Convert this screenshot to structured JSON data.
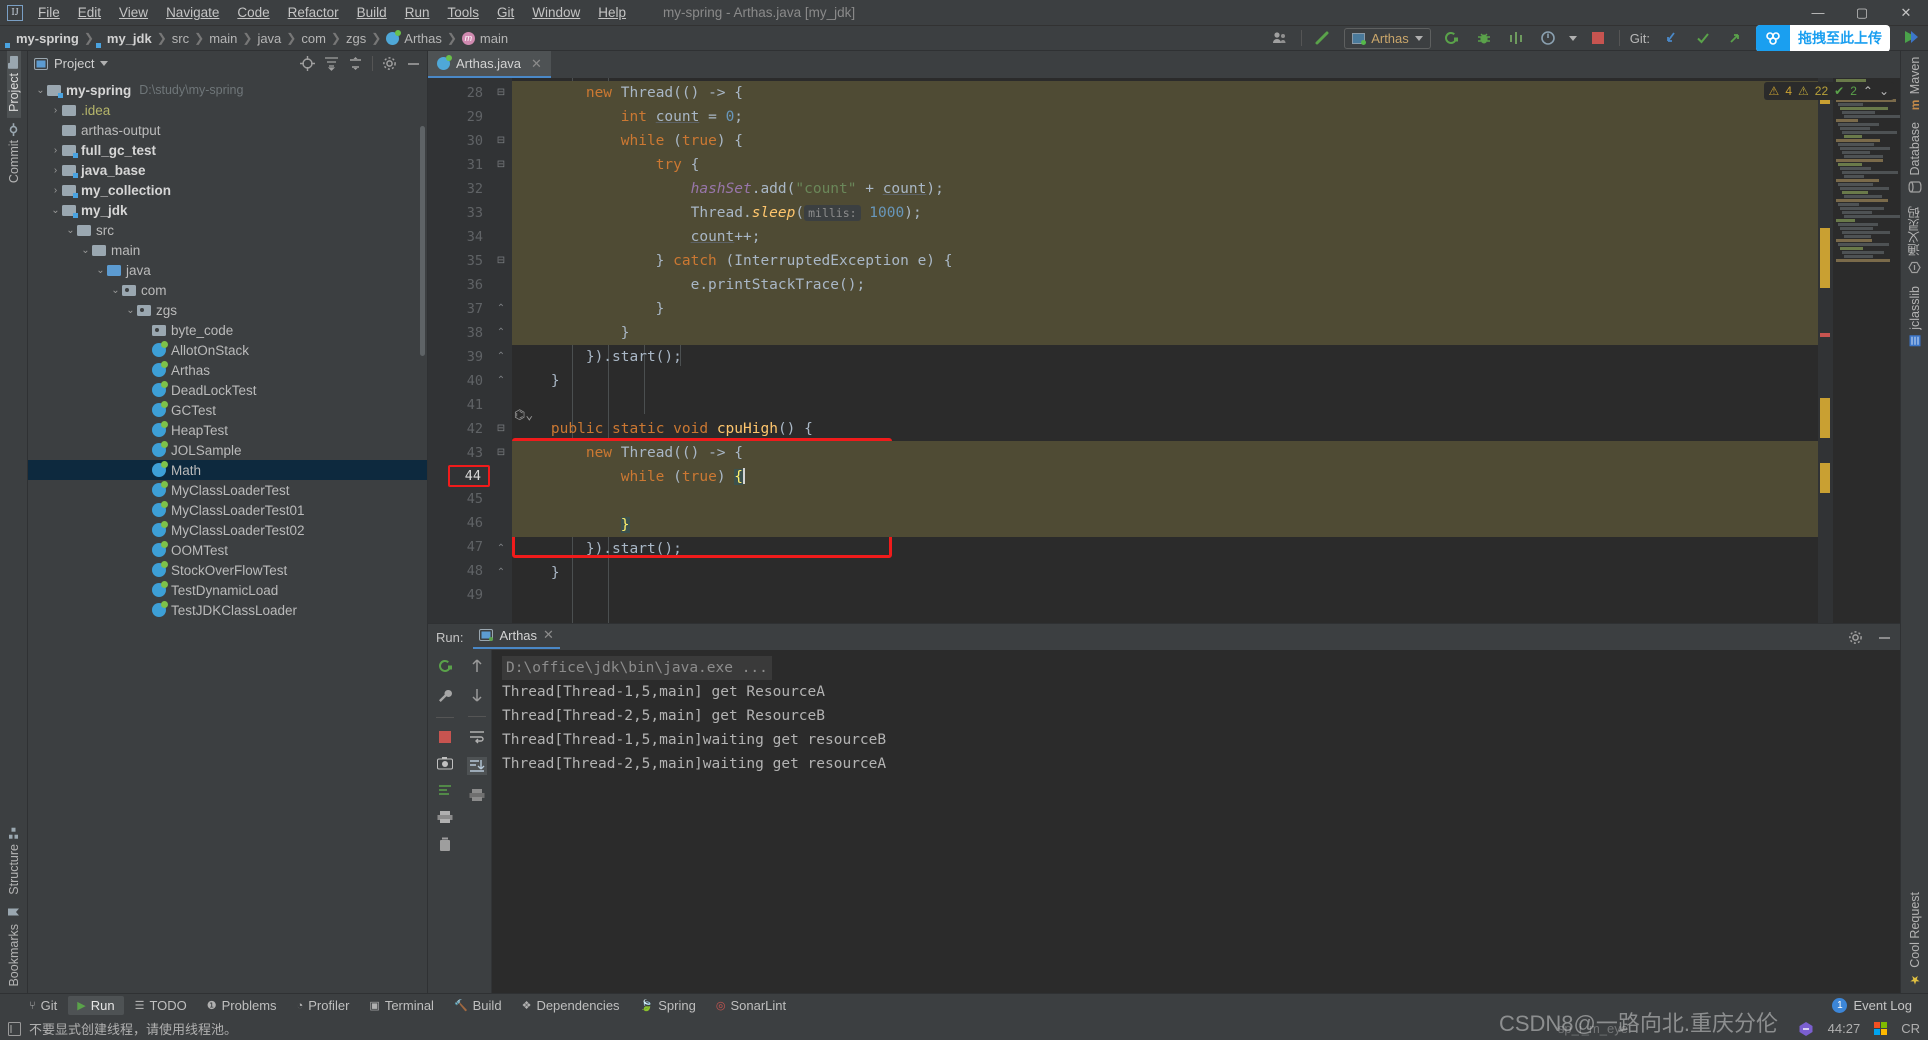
{
  "window": {
    "title": "my-spring - Arthas.java [my_jdk]",
    "logo": "intellij-idea-logo",
    "minimize": "—",
    "maximize": "▢",
    "close": "✕"
  },
  "menu": [
    "File",
    "Edit",
    "View",
    "Navigate",
    "Code",
    "Refactor",
    "Build",
    "Run",
    "Tools",
    "Git",
    "Window",
    "Help"
  ],
  "navbar": {
    "crumbs": [
      {
        "label": "my-spring",
        "bold": true,
        "icon": ""
      },
      {
        "label": "my_jdk",
        "bold": true,
        "icon": ""
      },
      {
        "label": "src",
        "bold": false,
        "icon": ""
      },
      {
        "label": "main",
        "bold": false,
        "icon": ""
      },
      {
        "label": "java",
        "bold": false,
        "icon": ""
      },
      {
        "label": "com",
        "bold": false,
        "icon": ""
      },
      {
        "label": "zgs",
        "bold": false,
        "icon": ""
      },
      {
        "label": "Arthas",
        "bold": false,
        "icon": "class-icon"
      },
      {
        "label": "main",
        "bold": false,
        "icon": "method-icon"
      }
    ],
    "run_config": "Arthas",
    "git_label": "Git:",
    "upload_widget": "拖拽至此上传",
    "icons": [
      "user-group-icon",
      "build-hammer-icon",
      "rerun-icon",
      "debug-bug-icon",
      "coverage-icon",
      "profiler-icon",
      "stop-icon",
      "git-update-icon",
      "git-commit-icon",
      "git-push-icon",
      "search-icon"
    ]
  },
  "left_rail": {
    "top": [
      {
        "label": "Project",
        "selected": true
      },
      {
        "label": "Commit",
        "selected": false
      }
    ],
    "bottom": [
      {
        "label": "Structure",
        "selected": false
      },
      {
        "label": "Bookmarks",
        "selected": false
      }
    ]
  },
  "right_rail": {
    "items": [
      "Maven",
      "Database",
      "通义灵码",
      "jclasslib",
      "Cool Request"
    ]
  },
  "project_panel": {
    "title": "Project",
    "tools": [
      "target-icon",
      "expand-all-icon",
      "collapse-all-icon",
      "settings-gear-icon",
      "hide-icon"
    ],
    "tree": [
      {
        "depth": 0,
        "arrow": "v",
        "icon": "module-folder",
        "label": "my-spring",
        "bold": true,
        "path": "D:\\study\\my-spring"
      },
      {
        "depth": 1,
        "arrow": ">",
        "icon": "folder",
        "label": ".idea",
        "color": "yellow"
      },
      {
        "depth": 1,
        "arrow": "",
        "icon": "folder",
        "label": "arthas-output"
      },
      {
        "depth": 1,
        "arrow": ">",
        "icon": "module-folder",
        "label": "full_gc_test",
        "bold": true
      },
      {
        "depth": 1,
        "arrow": ">",
        "icon": "module-folder",
        "label": "java_base",
        "bold": true
      },
      {
        "depth": 1,
        "arrow": ">",
        "icon": "module-folder",
        "label": "my_collection",
        "bold": true
      },
      {
        "depth": 1,
        "arrow": "v",
        "icon": "module-folder",
        "label": "my_jdk",
        "bold": true
      },
      {
        "depth": 2,
        "arrow": "v",
        "icon": "folder",
        "label": "src"
      },
      {
        "depth": 3,
        "arrow": "v",
        "icon": "folder",
        "label": "main"
      },
      {
        "depth": 4,
        "arrow": "v",
        "icon": "source-folder",
        "label": "java"
      },
      {
        "depth": 5,
        "arrow": "v",
        "icon": "package",
        "label": "com"
      },
      {
        "depth": 6,
        "arrow": "v",
        "icon": "package",
        "label": "zgs"
      },
      {
        "depth": 7,
        "arrow": "",
        "icon": "package",
        "label": "byte_code"
      },
      {
        "depth": 7,
        "arrow": "",
        "icon": "java-class",
        "label": "AllotOnStack"
      },
      {
        "depth": 7,
        "arrow": "",
        "icon": "java-class",
        "label": "Arthas"
      },
      {
        "depth": 7,
        "arrow": "",
        "icon": "java-class",
        "label": "DeadLockTest"
      },
      {
        "depth": 7,
        "arrow": "",
        "icon": "java-class",
        "label": "GCTest"
      },
      {
        "depth": 7,
        "arrow": "",
        "icon": "java-class",
        "label": "HeapTest"
      },
      {
        "depth": 7,
        "arrow": "",
        "icon": "java-class",
        "label": "JOLSample"
      },
      {
        "depth": 7,
        "arrow": "",
        "icon": "java-class",
        "label": "Math",
        "selected": true
      },
      {
        "depth": 7,
        "arrow": "",
        "icon": "java-class",
        "label": "MyClassLoaderTest"
      },
      {
        "depth": 7,
        "arrow": "",
        "icon": "java-class",
        "label": "MyClassLoaderTest01"
      },
      {
        "depth": 7,
        "arrow": "",
        "icon": "java-class",
        "label": "MyClassLoaderTest02"
      },
      {
        "depth": 7,
        "arrow": "",
        "icon": "java-class",
        "label": "OOMTest"
      },
      {
        "depth": 7,
        "arrow": "",
        "icon": "java-class",
        "label": "StockOverFlowTest"
      },
      {
        "depth": 7,
        "arrow": "",
        "icon": "java-class",
        "label": "TestDynamicLoad"
      },
      {
        "depth": 7,
        "arrow": "",
        "icon": "java-class",
        "label": "TestJDKClassLoader"
      }
    ]
  },
  "editor": {
    "tab": {
      "label": "Arthas.java",
      "icon": "java-class",
      "close": "✕"
    },
    "inspections": {
      "errors": "4",
      "warnings": "22",
      "checks": "2",
      "up": "⌃",
      "down": "⌄"
    },
    "lines": [
      {
        "n": 28,
        "fold": "-",
        "hl": true,
        "html": "        <span class='kw'>new</span> Thread(() -&gt; {"
      },
      {
        "n": 29,
        "fold": "",
        "hl": true,
        "html": "            <span class='kw'>int</span> <span class='var'>count</span> = <span class='num'>0</span>;"
      },
      {
        "n": 30,
        "fold": "-",
        "hl": true,
        "html": "            <span class='kw'>while</span> (<span class='kw'>true</span>) {"
      },
      {
        "n": 31,
        "fold": "-",
        "hl": true,
        "html": "                <span class='kw'>try</span> {"
      },
      {
        "n": 32,
        "fold": "",
        "hl": true,
        "html": "                    <span class='fld'>hashSet</span>.add(<span class='str'>\"count\"</span> + <span class='var'>count</span>);"
      },
      {
        "n": 33,
        "fold": "",
        "hl": true,
        "html": "                    Thread.<span class='mth' style='font-style:italic'>sleep</span>(<span class='hint'>millis:</span> <span class='num'>1000</span>);"
      },
      {
        "n": 34,
        "fold": "",
        "hl": true,
        "html": "                    <span class='var'>count</span>++;"
      },
      {
        "n": 35,
        "fold": "-",
        "hl": true,
        "html": "                } <span class='kw'>catch</span> (InterruptedException e) {"
      },
      {
        "n": 36,
        "fold": "",
        "hl": true,
        "html": "                    e.printStackTrace();"
      },
      {
        "n": 37,
        "fold": "^",
        "hl": true,
        "html": "                }"
      },
      {
        "n": 38,
        "fold": "^",
        "hl": true,
        "html": "            }"
      },
      {
        "n": 39,
        "fold": "^",
        "hl": false,
        "html": "        }).start();"
      },
      {
        "n": 40,
        "fold": "^",
        "hl": false,
        "html": "    }"
      },
      {
        "n": 41,
        "fold": "",
        "hl": false,
        "html": ""
      },
      {
        "n": 42,
        "fold": "-",
        "hl": false,
        "html": "    <span class='kw'>public</span> <span class='kw'>static</span> <span class='kw'>void</span> <span class='mth'>cpuHigh</span>() {"
      },
      {
        "n": 43,
        "fold": "-",
        "hl": true,
        "html": "        <span class='kw'>new</span> Thread(() -&gt; {"
      },
      {
        "n": 44,
        "fold": "",
        "hl": true,
        "html": "            <span class='kw'>while</span> (<span class='kw'>true</span>) <span class='brmatch'>{</span><span class='caretln'></span>"
      },
      {
        "n": 45,
        "fold": "",
        "hl": true,
        "html": ""
      },
      {
        "n": 46,
        "fold": "",
        "hl": true,
        "html": "            <span class='brmatch'>}</span>"
      },
      {
        "n": 47,
        "fold": "^",
        "hl": false,
        "html": "        }).start();"
      },
      {
        "n": 48,
        "fold": "^",
        "hl": false,
        "html": "    }"
      },
      {
        "n": 49,
        "fold": "",
        "hl": false,
        "html": ""
      }
    ],
    "gutter_icon_line": 42,
    "highlight_box": "red-annotation-rectangle",
    "highlight_line_number": "44"
  },
  "run_panel": {
    "label": "Run:",
    "tab": "Arthas",
    "tab_close": "✕",
    "rail_icons": [
      "rerun-icon",
      "wrench-settings-icon",
      "stop-icon",
      "camera-icon",
      "thread-dump-icon",
      "print-icon",
      "trash-icon"
    ],
    "rail2_icons": [
      "scroll-up-icon",
      "scroll-down-icon",
      "soft-wrap-icon",
      "scroll-to-end-icon",
      "print-icon"
    ],
    "head_icons": [
      "settings-gear-icon",
      "hide-icon"
    ],
    "console": [
      {
        "text": "D:\\office\\jdk\\bin\\java.exe ...",
        "type": "command"
      },
      {
        "text": "Thread[Thread-1,5,main] get ResourceA",
        "type": "out"
      },
      {
        "text": "Thread[Thread-2,5,main] get ResourceB",
        "type": "out"
      },
      {
        "text": "Thread[Thread-1,5,main]waiting get resourceB",
        "type": "out"
      },
      {
        "text": "Thread[Thread-2,5,main]waiting get resourceA",
        "type": "out"
      }
    ]
  },
  "tool_strip": [
    {
      "label": "Git",
      "icon": "git-branch-icon",
      "selected": false
    },
    {
      "label": "Run",
      "icon": "run-play-icon",
      "selected": true
    },
    {
      "label": "TODO",
      "icon": "todo-list-icon",
      "selected": false
    },
    {
      "label": "Problems",
      "icon": "problems-icon",
      "selected": false
    },
    {
      "label": "Profiler",
      "icon": "profiler-icon",
      "selected": false
    },
    {
      "label": "Terminal",
      "icon": "terminal-icon",
      "selected": false
    },
    {
      "label": "Build",
      "icon": "build-hammer-icon",
      "selected": false
    },
    {
      "label": "Dependencies",
      "icon": "dependencies-icon",
      "selected": false
    },
    {
      "label": "Spring",
      "icon": "spring-leaf-icon",
      "selected": false
    },
    {
      "label": "SonarLint",
      "icon": "sonarlint-icon",
      "selected": false
    }
  ],
  "status_bar": {
    "message": "不要显式创建线程，请使用线程池。",
    "message_icon": "inspection-icon",
    "event_log": "Event Log",
    "event_badge": "1",
    "caret_position": "44:27",
    "indicator_icon": "tongyi-icon",
    "windows_icon": "windows-icon",
    "crlf": "CR",
    "watermark": "CSDN8@一路向北.重庆分伦",
    "watermark_sub": "sp_i_m_eye"
  }
}
